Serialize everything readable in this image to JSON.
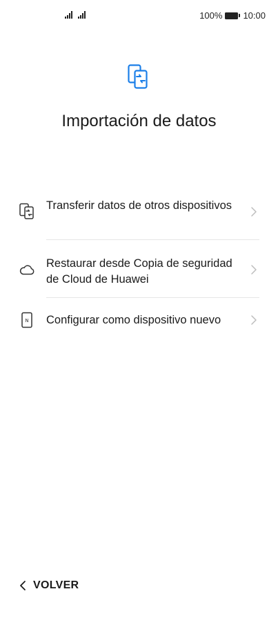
{
  "status_bar": {
    "battery_percent": "100%",
    "time": "10:00",
    "icons": [
      "signal-icon",
      "signal-icon",
      "battery-icon"
    ]
  },
  "header": {
    "icon": "phone-transfer-icon",
    "accent_color": "#1a7ee8",
    "title": "Importación de datos"
  },
  "options": [
    {
      "icon": "phone-transfer-icon",
      "label": "Transferir datos de otros dispositivos"
    },
    {
      "icon": "cloud-icon",
      "label": "Restaurar desde Copia de seguridad de Cloud de Huawei"
    },
    {
      "icon": "new-device-icon",
      "label": "Configurar como dispositivo nuevo"
    }
  ],
  "footer": {
    "back_icon": "chevron-left-icon",
    "back_label": "VOLVER"
  }
}
